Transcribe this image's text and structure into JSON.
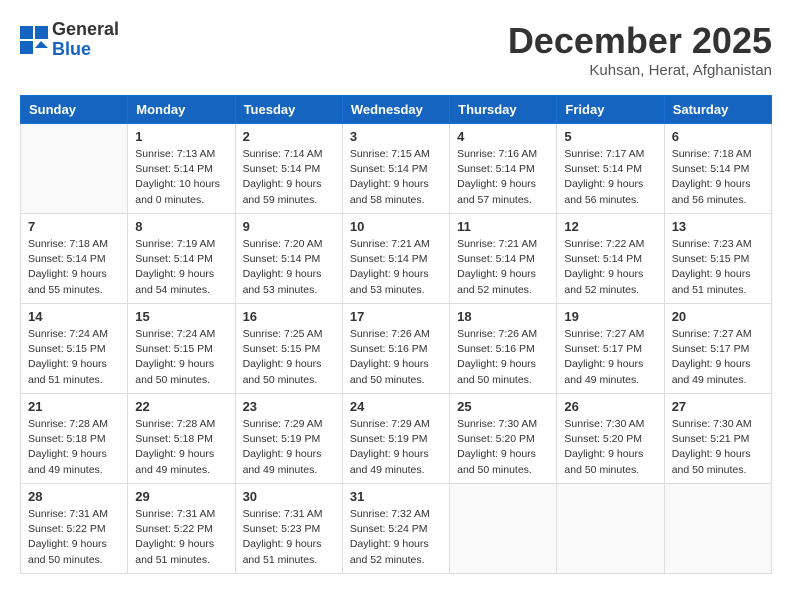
{
  "logo": {
    "line1": "General",
    "line2": "Blue"
  },
  "title": "December 2025",
  "location": "Kuhsan, Herat, Afghanistan",
  "weekdays": [
    "Sunday",
    "Monday",
    "Tuesday",
    "Wednesday",
    "Thursday",
    "Friday",
    "Saturday"
  ],
  "weeks": [
    [
      {
        "day": "",
        "info": ""
      },
      {
        "day": "1",
        "info": "Sunrise: 7:13 AM\nSunset: 5:14 PM\nDaylight: 10 hours\nand 0 minutes."
      },
      {
        "day": "2",
        "info": "Sunrise: 7:14 AM\nSunset: 5:14 PM\nDaylight: 9 hours\nand 59 minutes."
      },
      {
        "day": "3",
        "info": "Sunrise: 7:15 AM\nSunset: 5:14 PM\nDaylight: 9 hours\nand 58 minutes."
      },
      {
        "day": "4",
        "info": "Sunrise: 7:16 AM\nSunset: 5:14 PM\nDaylight: 9 hours\nand 57 minutes."
      },
      {
        "day": "5",
        "info": "Sunrise: 7:17 AM\nSunset: 5:14 PM\nDaylight: 9 hours\nand 56 minutes."
      },
      {
        "day": "6",
        "info": "Sunrise: 7:18 AM\nSunset: 5:14 PM\nDaylight: 9 hours\nand 56 minutes."
      }
    ],
    [
      {
        "day": "7",
        "info": "Sunrise: 7:18 AM\nSunset: 5:14 PM\nDaylight: 9 hours\nand 55 minutes."
      },
      {
        "day": "8",
        "info": "Sunrise: 7:19 AM\nSunset: 5:14 PM\nDaylight: 9 hours\nand 54 minutes."
      },
      {
        "day": "9",
        "info": "Sunrise: 7:20 AM\nSunset: 5:14 PM\nDaylight: 9 hours\nand 53 minutes."
      },
      {
        "day": "10",
        "info": "Sunrise: 7:21 AM\nSunset: 5:14 PM\nDaylight: 9 hours\nand 53 minutes."
      },
      {
        "day": "11",
        "info": "Sunrise: 7:21 AM\nSunset: 5:14 PM\nDaylight: 9 hours\nand 52 minutes."
      },
      {
        "day": "12",
        "info": "Sunrise: 7:22 AM\nSunset: 5:14 PM\nDaylight: 9 hours\nand 52 minutes."
      },
      {
        "day": "13",
        "info": "Sunrise: 7:23 AM\nSunset: 5:15 PM\nDaylight: 9 hours\nand 51 minutes."
      }
    ],
    [
      {
        "day": "14",
        "info": "Sunrise: 7:24 AM\nSunset: 5:15 PM\nDaylight: 9 hours\nand 51 minutes."
      },
      {
        "day": "15",
        "info": "Sunrise: 7:24 AM\nSunset: 5:15 PM\nDaylight: 9 hours\nand 50 minutes."
      },
      {
        "day": "16",
        "info": "Sunrise: 7:25 AM\nSunset: 5:15 PM\nDaylight: 9 hours\nand 50 minutes."
      },
      {
        "day": "17",
        "info": "Sunrise: 7:26 AM\nSunset: 5:16 PM\nDaylight: 9 hours\nand 50 minutes."
      },
      {
        "day": "18",
        "info": "Sunrise: 7:26 AM\nSunset: 5:16 PM\nDaylight: 9 hours\nand 50 minutes."
      },
      {
        "day": "19",
        "info": "Sunrise: 7:27 AM\nSunset: 5:17 PM\nDaylight: 9 hours\nand 49 minutes."
      },
      {
        "day": "20",
        "info": "Sunrise: 7:27 AM\nSunset: 5:17 PM\nDaylight: 9 hours\nand 49 minutes."
      }
    ],
    [
      {
        "day": "21",
        "info": "Sunrise: 7:28 AM\nSunset: 5:18 PM\nDaylight: 9 hours\nand 49 minutes."
      },
      {
        "day": "22",
        "info": "Sunrise: 7:28 AM\nSunset: 5:18 PM\nDaylight: 9 hours\nand 49 minutes."
      },
      {
        "day": "23",
        "info": "Sunrise: 7:29 AM\nSunset: 5:19 PM\nDaylight: 9 hours\nand 49 minutes."
      },
      {
        "day": "24",
        "info": "Sunrise: 7:29 AM\nSunset: 5:19 PM\nDaylight: 9 hours\nand 49 minutes."
      },
      {
        "day": "25",
        "info": "Sunrise: 7:30 AM\nSunset: 5:20 PM\nDaylight: 9 hours\nand 50 minutes."
      },
      {
        "day": "26",
        "info": "Sunrise: 7:30 AM\nSunset: 5:20 PM\nDaylight: 9 hours\nand 50 minutes."
      },
      {
        "day": "27",
        "info": "Sunrise: 7:30 AM\nSunset: 5:21 PM\nDaylight: 9 hours\nand 50 minutes."
      }
    ],
    [
      {
        "day": "28",
        "info": "Sunrise: 7:31 AM\nSunset: 5:22 PM\nDaylight: 9 hours\nand 50 minutes."
      },
      {
        "day": "29",
        "info": "Sunrise: 7:31 AM\nSunset: 5:22 PM\nDaylight: 9 hours\nand 51 minutes."
      },
      {
        "day": "30",
        "info": "Sunrise: 7:31 AM\nSunset: 5:23 PM\nDaylight: 9 hours\nand 51 minutes."
      },
      {
        "day": "31",
        "info": "Sunrise: 7:32 AM\nSunset: 5:24 PM\nDaylight: 9 hours\nand 52 minutes."
      },
      {
        "day": "",
        "info": ""
      },
      {
        "day": "",
        "info": ""
      },
      {
        "day": "",
        "info": ""
      }
    ]
  ]
}
